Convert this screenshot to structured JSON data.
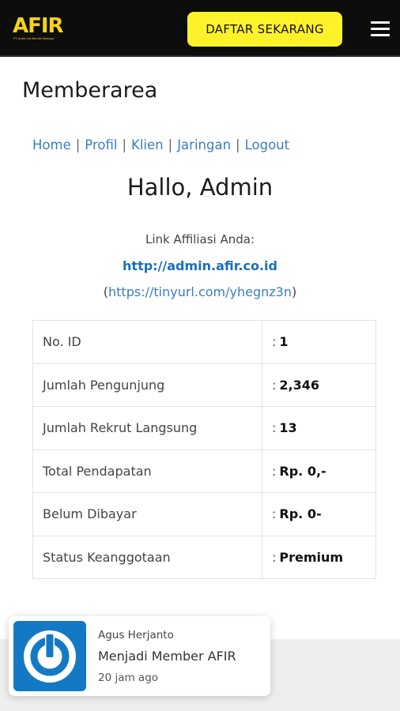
{
  "header": {
    "logo": {
      "text": "AFIR",
      "subtext": "PT. Arafa Inti Mandiri Berbagi"
    },
    "cta_label": "DAFTAR SEKARANG",
    "menu_icon": "hamburger-icon"
  },
  "page": {
    "title": "Memberarea",
    "nav": [
      "Home",
      "Profil",
      "Klien",
      "Jaringan",
      "Logout"
    ],
    "nav_separator": "|",
    "greeting": "Hallo, Admin",
    "affiliate": {
      "label": "Link Affiliasi Anda:",
      "link": "http://admin.afir.co.id",
      "short_link": "https://tinyurl.com/yhegnz3n",
      "short_open": "(",
      "short_close": ")"
    }
  },
  "stats": {
    "colon": ":",
    "rows": [
      {
        "label": "No. ID",
        "value": "1"
      },
      {
        "label": "Jumlah Pengunjung",
        "value": "2,346"
      },
      {
        "label": "Jumlah Rekrut Langsung",
        "value": "13"
      },
      {
        "label": "Total Pendapatan",
        "value": "Rp. 0,-"
      },
      {
        "label": "Belum Dibayar",
        "value": "Rp. 0-"
      },
      {
        "label": "Status Keanggotaan",
        "value": "Premium"
      }
    ]
  },
  "notification": {
    "icon": "power-icon",
    "name": "Agus Herjanto",
    "message": "Menjadi Member AFIR",
    "time": "20 jam ago"
  },
  "colors": {
    "header_bg": "#0d0d0d",
    "brand_yellow": "#f5d21a",
    "cta_bg": "#fff22b",
    "link_blue": "#3a7dc0",
    "affiliate_blue": "#1a6fb8",
    "toast_icon_bg": "#1479c4"
  }
}
